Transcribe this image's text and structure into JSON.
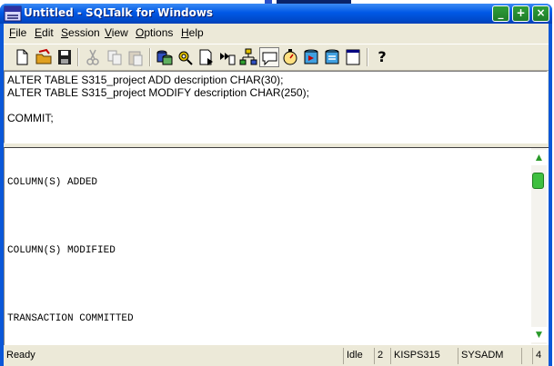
{
  "window": {
    "title": "Untitled - SQLTalk for Windows",
    "controls": [
      "_",
      "+",
      "×"
    ]
  },
  "menu": {
    "items": [
      {
        "label": "File",
        "mnemonic": "F",
        "rest": "ile"
      },
      {
        "label": "Edit",
        "mnemonic": "E",
        "rest": "dit"
      },
      {
        "label": "Session",
        "mnemonic": "S",
        "rest": "ession"
      },
      {
        "label": "View",
        "mnemonic": "V",
        "rest": "iew"
      },
      {
        "label": "Options",
        "mnemonic": "O",
        "rest": "ptions"
      },
      {
        "label": "Help",
        "mnemonic": "H",
        "rest": "elp"
      }
    ]
  },
  "toolbar": {
    "buttons": [
      {
        "icon": "new-document-icon",
        "enabled": true
      },
      {
        "icon": "open-folder-icon",
        "enabled": true
      },
      {
        "icon": "save-disk-icon",
        "enabled": true
      },
      {
        "icon": "cut-scissors-icon",
        "enabled": false
      },
      {
        "icon": "copy-icon",
        "enabled": false
      },
      {
        "icon": "paste-clipboard-icon",
        "enabled": false
      },
      {
        "icon": "connect-icon",
        "enabled": true
      },
      {
        "icon": "disconnect-icon",
        "enabled": true
      },
      {
        "icon": "execute-statement-icon",
        "enabled": true
      },
      {
        "icon": "execute-script-icon",
        "enabled": true
      },
      {
        "icon": "tree-view-icon",
        "enabled": true
      },
      {
        "icon": "comment-bubble-icon",
        "enabled": true,
        "active": true
      },
      {
        "icon": "stopwatch-icon",
        "enabled": true
      },
      {
        "icon": "database-run-icon",
        "enabled": true
      },
      {
        "icon": "database-list-icon",
        "enabled": true
      },
      {
        "icon": "window-icon",
        "enabled": true
      },
      {
        "icon": "help-question-icon",
        "enabled": true
      }
    ],
    "help_glyph": "?"
  },
  "editor": {
    "lines": [
      "ALTER TABLE S315_project ADD description CHAR(30);",
      "ALTER TABLE S315_project MODIFY description CHAR(250);",
      "",
      "COMMIT;"
    ]
  },
  "output": {
    "lines": [
      "COLUMN(S) ADDED",
      "COLUMN(S) MODIFIED",
      "TRANSACTION COMMITTED"
    ]
  },
  "scrollbar": {
    "up_glyph": "▲",
    "down_glyph": "▼"
  },
  "status": {
    "message": "Ready",
    "state": "Idle",
    "cursor_count": "2",
    "database": "KISPS315",
    "user": "SYSADM",
    "count": "4"
  },
  "colors": {
    "title_bar": "#0058e6",
    "window_frame": "#0a57d8",
    "control_buttons": "#1f7d2a",
    "scroll_thumb": "#3fbf3f"
  }
}
